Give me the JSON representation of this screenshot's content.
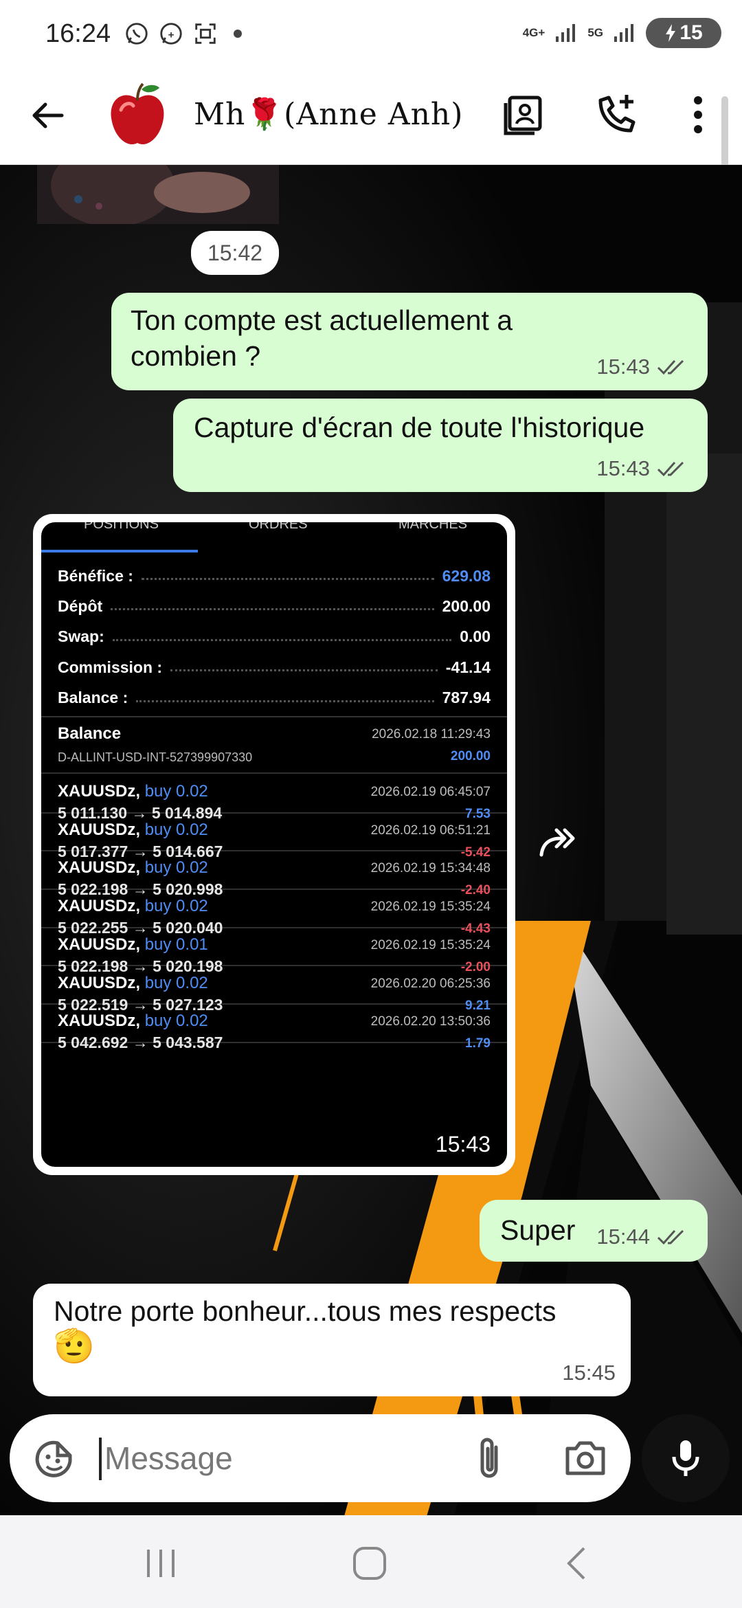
{
  "status_bar": {
    "time": "16:24",
    "network_1": "4G+",
    "network_2": "5G",
    "battery": "15"
  },
  "header": {
    "contact_name": "Mh🌹(Anne Anh)"
  },
  "messages": {
    "media_time": "15:42",
    "m1_text_line1": "Ton compte est actuellement a",
    "m1_text_line2": "combien ?",
    "m1_time": "15:43",
    "m2_text": "Capture d'écran de toute l'historique",
    "m2_time": "15:43",
    "image_time": "15:43",
    "m3_text": "Super",
    "m3_time": "15:44",
    "m4_text": "Notre porte bonheur...tous mes respects",
    "m4_emoji": "🫡",
    "m4_time": "15:45"
  },
  "screenshot": {
    "tabs": [
      "POSITIONS",
      "ORDRES",
      "MARCHÉS"
    ],
    "summary": [
      {
        "label": "Bénéfice :",
        "value": "629.08",
        "color": "#4f8df5"
      },
      {
        "label": "Dépôt",
        "value": "200.00",
        "color": "#ffffff"
      },
      {
        "label": "Swap:",
        "value": "0.00",
        "color": "#ffffff"
      },
      {
        "label": "Commission :",
        "value": "-41.14",
        "color": "#ffffff"
      },
      {
        "label": "Balance :",
        "value": "787.94",
        "color": "#ffffff"
      }
    ],
    "balance_entry": {
      "title": "Balance",
      "account": "D-ALLINT-USD-INT-527399907330",
      "date": "2026.02.18 11:29:43",
      "amount": "200.00"
    },
    "trades": [
      {
        "symbol": "XAUUSDz,",
        "side": "buy 0.02",
        "prices": "5 011.130 → 5 014.894",
        "date": "2026.02.19 06:45:07",
        "profit": "7.53",
        "color": "#4f8df5"
      },
      {
        "symbol": "XAUUSDz,",
        "side": "buy 0.02",
        "prices": "5 017.377 → 5 014.667",
        "date": "2026.02.19 06:51:21",
        "profit": "-5.42",
        "color": "#e8505b"
      },
      {
        "symbol": "XAUUSDz,",
        "side": "buy 0.02",
        "prices": "5 022.198 → 5 020.998",
        "date": "2026.02.19 15:34:48",
        "profit": "-2.40",
        "color": "#e8505b"
      },
      {
        "symbol": "XAUUSDz,",
        "side": "buy 0.02",
        "prices": "5 022.255 → 5 020.040",
        "date": "2026.02.19 15:35:24",
        "profit": "-4.43",
        "color": "#e8505b"
      },
      {
        "symbol": "XAUUSDz,",
        "side": "buy 0.01",
        "prices": "5 022.198 → 5 020.198",
        "date": "2026.02.19 15:35:24",
        "profit": "-2.00",
        "color": "#e8505b"
      },
      {
        "symbol": "XAUUSDz,",
        "side": "buy 0.02",
        "prices": "5 022.519 → 5 027.123",
        "date": "2026.02.20 06:25:36",
        "profit": "9.21",
        "color": "#4f8df5"
      },
      {
        "symbol": "XAUUSDz,",
        "side": "buy 0.02",
        "prices": "5 042.692 → 5 043.587",
        "date": "2026.02.20 13:50:36",
        "profit": "1.79",
        "color": "#4f8df5"
      }
    ]
  },
  "input": {
    "placeholder": "Message"
  },
  "colors": {
    "outgoing_bubble": "#d9fdd3",
    "incoming_bubble": "#ffffff",
    "accent_blue": "#4f8df5",
    "loss_red": "#e8505b",
    "bg_orange": "#f39a12"
  },
  "icons": {
    "back": "arrow-left-icon",
    "contact_card": "contact-card-icon",
    "add_call": "phone-plus-icon",
    "more": "more-vert-icon",
    "forward": "forward-icon",
    "emoji": "sticker-icon",
    "attach": "paperclip-icon",
    "camera": "camera-icon",
    "mic": "mic-icon"
  }
}
